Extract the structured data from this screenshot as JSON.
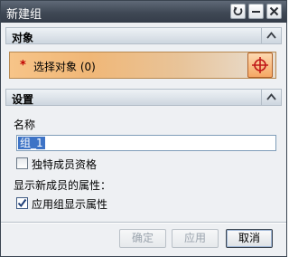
{
  "window": {
    "title": "新建组"
  },
  "sections": {
    "object": {
      "title": "对象",
      "required_marker": "*",
      "select_label": "选择对象 (0)"
    },
    "settings": {
      "title": "设置",
      "name_label": "名称",
      "name_value": "组_1",
      "exclusive_membership_label": "独特成员资格",
      "exclusive_membership_checked": false,
      "display_new_members_label": "显示新成员的属性：",
      "apply_group_display_label": "应用组显示属性",
      "apply_group_display_checked": true
    }
  },
  "buttons": {
    "ok": "确定",
    "apply": "应用",
    "cancel": "取消"
  },
  "colors": {
    "titlebar": "#3f4855",
    "selection_accent": "#f0b777",
    "highlight": "#3d73c6"
  },
  "icons": {
    "titlebar": [
      "reset-icon",
      "minimize-icon",
      "close-icon"
    ],
    "collapse": "chevron-up-icon",
    "select": "crosshair-icon"
  }
}
